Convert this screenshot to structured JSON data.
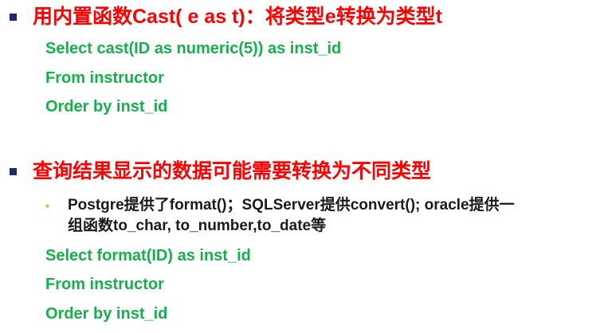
{
  "section1": {
    "heading": "用内置函数Cast( e as t)：将类型e转换为类型t",
    "code": [
      "Select cast(ID as numeric(5)) as inst_id",
      "From instructor",
      "Order by inst_id"
    ]
  },
  "section2": {
    "heading": "查询结果显示的数据可能需要转换为不同类型",
    "bullet": {
      "symbol": "•",
      "line1": "Postgre提供了format()；SQLServer提供convert(); oracle提供一",
      "line2": "组函数to_char, to_number,to_date等"
    },
    "code": [
      "Select format(ID) as inst_id",
      "From instructor",
      "Order by inst_id"
    ]
  },
  "colors": {
    "heading": "#ff0000",
    "code": "#14b14b",
    "bullet_square": "#1f2a6b",
    "sub_bullet": "#f0a23c",
    "body_text": "#1a1a1a"
  }
}
